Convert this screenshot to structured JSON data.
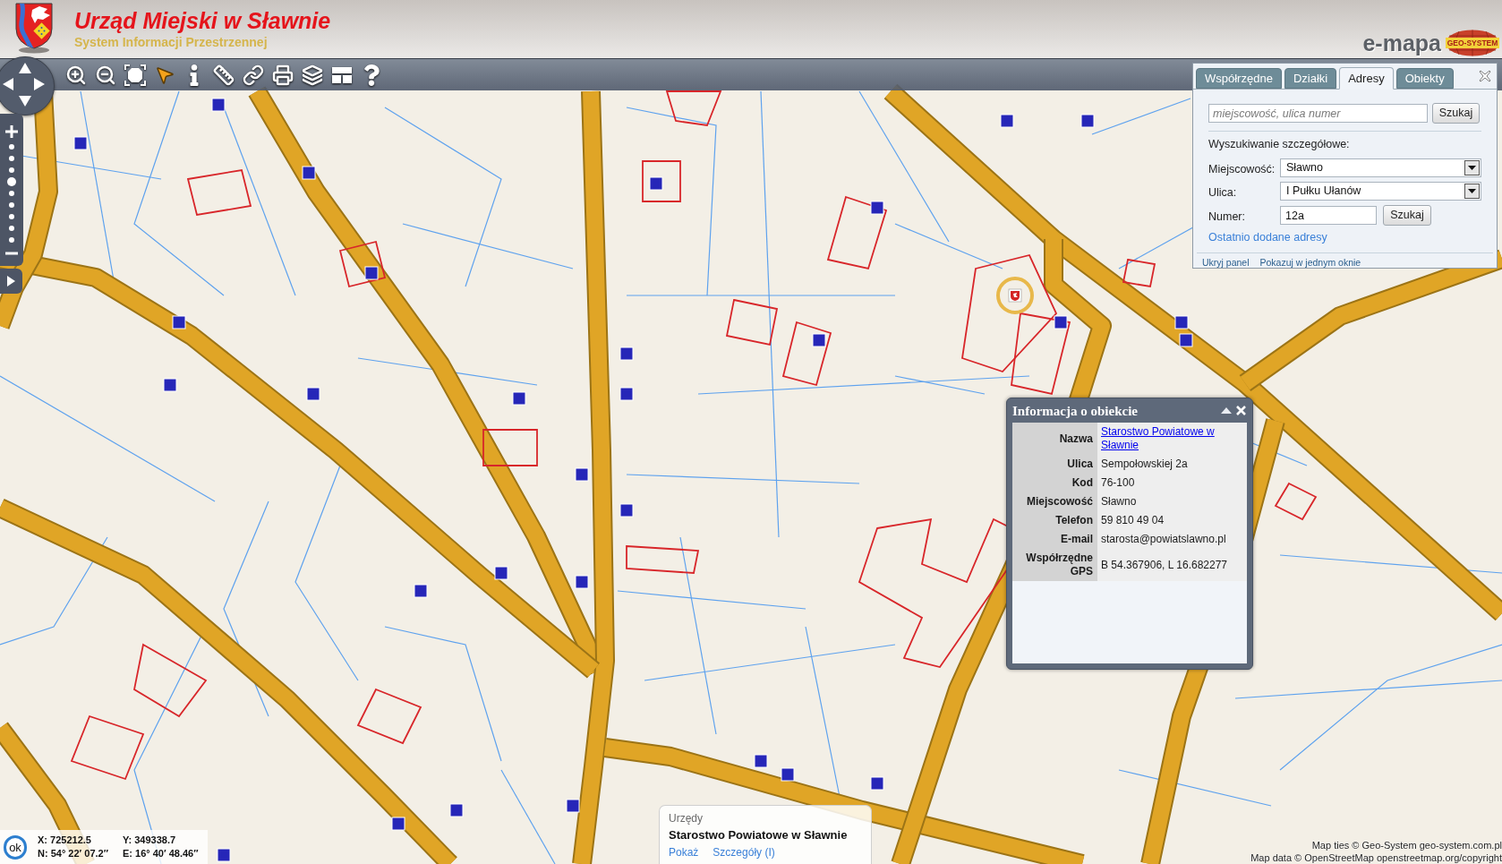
{
  "header": {
    "title": "Urząd Miejski w Sławnie",
    "subtitle": "System Informacji Przestrzennej",
    "brand": "e-mapa",
    "brand_badge": "GEO-SYSTEM"
  },
  "zoom": {
    "level": 0.625
  },
  "search_panel": {
    "tabs": [
      {
        "label": "Współrzędne",
        "selected": false
      },
      {
        "label": "Działki",
        "selected": false
      },
      {
        "label": "Adresy",
        "selected": true
      },
      {
        "label": "Obiekty",
        "selected": false
      }
    ],
    "quick_search": {
      "placeholder": "miejscowość, ulica numer",
      "button": "Szukaj"
    },
    "detail_heading": "Wyszukiwanie szczegółowe:",
    "fields": [
      {
        "kind": "select",
        "label": "Miejscowość:",
        "value": "Sławno"
      },
      {
        "kind": "select",
        "label": "Ulica:",
        "value": "I Pułku Ułanów"
      },
      {
        "kind": "input",
        "label": "Numer:",
        "value": "12a",
        "button": "Szukaj"
      }
    ],
    "recent_link": "Ostatnio dodane adresy",
    "footer_links": [
      "Ukryj panel",
      "Pokazuj w jednym oknie"
    ]
  },
  "info_popup": {
    "title": "Informacja o obiekcie",
    "rows": [
      {
        "kind": "link",
        "label": "Nazwa",
        "value": "Starostwo Powiatowe w Sławnie"
      },
      {
        "kind": "text",
        "label": "Ulica",
        "value": "Sempołowskiej 2a"
      },
      {
        "kind": "text",
        "label": "Kod",
        "value": "76-100"
      },
      {
        "kind": "text",
        "label": "Miejscowość",
        "value": "Sławno"
      },
      {
        "kind": "text",
        "label": "Telefon",
        "value": "59 810 49 04"
      },
      {
        "kind": "text",
        "label": "E-mail",
        "value": "starosta@powiatslawno.pl"
      },
      {
        "kind": "text",
        "label": "Współrzędne GPS",
        "value": "B 54.367906, L 16.682277"
      }
    ]
  },
  "coordinates": {
    "button": "ok",
    "values": [
      "X: 725212.5",
      "Y: 349338.7",
      "N: 54° 22′ 07.2″",
      "E: 16° 40′ 48.46″"
    ]
  },
  "result_popup": {
    "category": "Urzędy",
    "name": "Starostwo Powiatowe w Sławnie",
    "links": [
      "Pokaż",
      "Szczegóły (I)"
    ]
  },
  "attribution": [
    "Map ties © Geo-System geo-system.com.pl",
    "Map data © OpenStreetMap openstreetmap.org/copyright"
  ]
}
